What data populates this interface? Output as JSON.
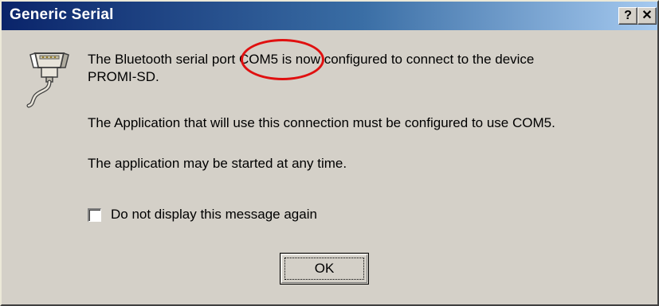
{
  "window": {
    "title": "Generic Serial",
    "help_label": "?",
    "close_label": "✕"
  },
  "message": {
    "line1_before": "The Bluetooth serial port ",
    "line1_port": "COM5",
    "line1_after": " is now configured to connect to the device",
    "line2": "PROMI-SD.",
    "line3": "The Application that will use this connection must be configured to use COM5.",
    "line4": "The application may be started at any time."
  },
  "checkbox": {
    "label": "Do not display this message again",
    "checked": false
  },
  "buttons": {
    "ok_label": "OK"
  },
  "icons": {
    "message_icon": "serial-port-connector-icon"
  },
  "colors": {
    "titlebar_start": "#0a246a",
    "titlebar_end": "#a6caf0",
    "dialog_face": "#d4d0c8",
    "annotation_circle": "#e01010"
  }
}
